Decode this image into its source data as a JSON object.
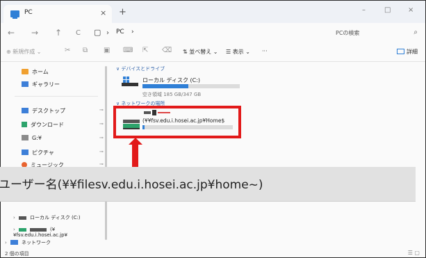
{
  "window": {
    "tab_title": "PC",
    "close_glyph": "×",
    "new_tab_glyph": "+",
    "minimize_glyph": "–",
    "maximize_glyph": "□",
    "close_window_glyph": "×"
  },
  "nav": {
    "back": "←",
    "forward": "→",
    "up": "↑",
    "refresh": "C",
    "address_icon": "▢",
    "address_sep": "›",
    "address_text": "PC",
    "address_chevron": "›"
  },
  "search": {
    "placeholder": "PCの検索",
    "icon_glyph": "⌕"
  },
  "toolbar": {
    "new_label": "⊕ 新規作成 ⌄",
    "sort_label": "⇅ 並べ替え ⌄",
    "view_label": "☰ 表示 ⌄",
    "more_label": "···",
    "details_label": "詳細"
  },
  "sidebar": {
    "home": "ホーム",
    "gallery": "ギャラリー",
    "desktop": "デスクトップ",
    "downloads": "ダウンロード",
    "g_drive": "G:¥",
    "pictures": "ピクチャ",
    "music": "ミュージック",
    "tree_local": "ローカル ディスク (C:)",
    "tree_network_drive": "(¥¥fsv.edu.i.hosei.ac.jp¥",
    "tree_network": "ネットワーク",
    "pin_glyph": "⊸"
  },
  "main": {
    "group_devices": "∨ デバイスとドライブ",
    "local_disk_name": "ローカル ディスク (C:)",
    "local_disk_size": "空き領域 185 GB/347 GB",
    "local_disk_fill": 0.47,
    "group_network": "∨ ネットワークの場所",
    "network_drive_name": "(¥¥fsv.edu.i.hosei.ac.jp¥Home$",
    "network_drive_fill": 0.02
  },
  "status": {
    "items": "2 個の項目",
    "view_icons": "☰ ▢"
  },
  "annotation": {
    "callout_text": "ユーザー名(¥¥filesv.edu.i.hosei.ac.jp¥home~)"
  },
  "colors": {
    "accent": "#2f7fd6",
    "annotation_red": "#e21a1a"
  }
}
